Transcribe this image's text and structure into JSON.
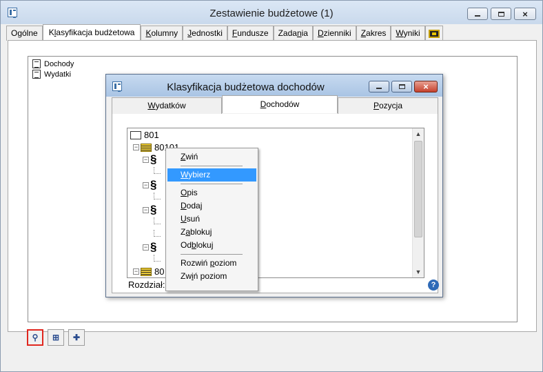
{
  "window": {
    "title": "Zestawienie budżetowe (1)"
  },
  "tabs": [
    {
      "pre": "Ogólne",
      "ul": "",
      "post": ""
    },
    {
      "pre": "K",
      "ul": "l",
      "post": "asyfikacja budżetowa"
    },
    {
      "pre": "",
      "ul": "K",
      "post": "olumny"
    },
    {
      "pre": "",
      "ul": "J",
      "post": "ednostki"
    },
    {
      "pre": "",
      "ul": "F",
      "post": "undusze"
    },
    {
      "pre": "Zada",
      "ul": "n",
      "post": "ia"
    },
    {
      "pre": "",
      "ul": "D",
      "post": "zienniki"
    },
    {
      "pre": "",
      "ul": "Z",
      "post": "akres"
    },
    {
      "pre": "",
      "ul": "W",
      "post": "yniki"
    }
  ],
  "main_tree": {
    "items": [
      "Dochody",
      "Wydatki"
    ]
  },
  "dialog": {
    "title": "Klasyfikacja budżetowa dochodów",
    "tabs": [
      {
        "pre": "",
        "ul": "W",
        "post": "ydatków"
      },
      {
        "pre": "",
        "ul": "D",
        "post": "ochodów"
      },
      {
        "pre": "",
        "ul": "P",
        "post": "ozycja"
      }
    ],
    "tree": {
      "root": "801",
      "child1": "80101",
      "child_last": "80"
    },
    "status_label": "Rozdział:"
  },
  "context_menu": {
    "items": [
      {
        "pre": "",
        "ul": "Z",
        "post": "wiń"
      },
      {
        "pre": "",
        "ul": "W",
        "post": "ybierz"
      },
      {
        "pre": "",
        "ul": "O",
        "post": "pis"
      },
      {
        "pre": "",
        "ul": "D",
        "post": "odaj"
      },
      {
        "pre": "",
        "ul": "U",
        "post": "suń"
      },
      {
        "pre": "Z",
        "ul": "a",
        "post": "blokuj"
      },
      {
        "pre": "Od",
        "ul": "b",
        "post": "lokuj"
      },
      {
        "pre": "Rozwiń ",
        "ul": "p",
        "post": "oziom"
      },
      {
        "pre": "Zw",
        "ul": "i",
        "post": "ń poziom"
      }
    ]
  },
  "icons": {
    "app": "app-window-icon",
    "tab_extra": "film-icon",
    "bottom": [
      "binoculars-icon",
      "tree-link-icon",
      "add-table-icon"
    ],
    "help": "help-globe-icon"
  }
}
